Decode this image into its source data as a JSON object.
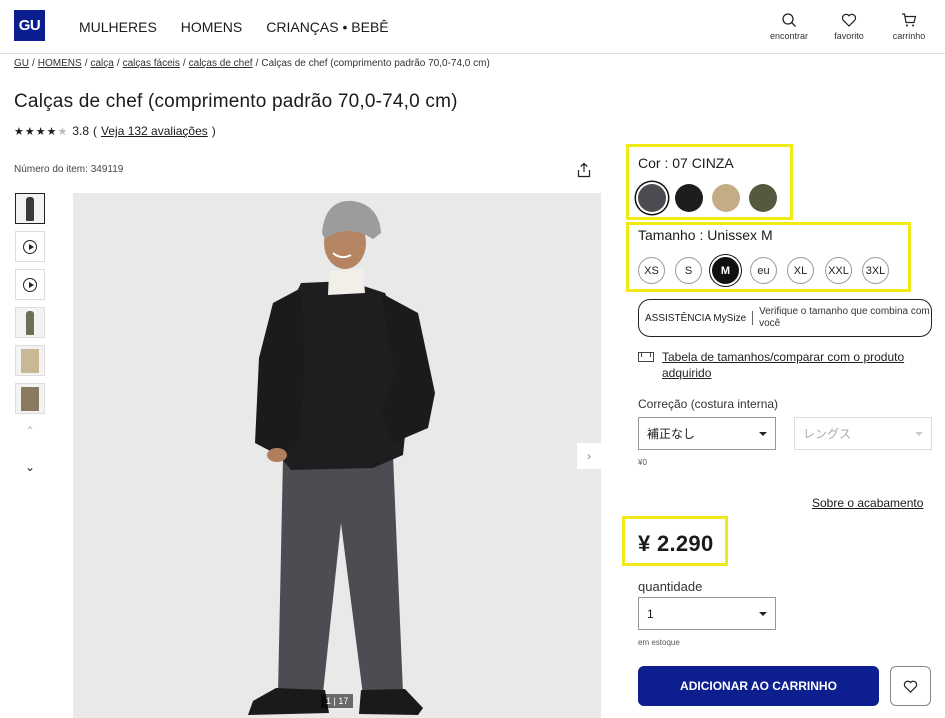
{
  "header": {
    "logo": "GU",
    "nav": [
      "MULHERES",
      "HOMENS",
      "CRIANÇAS • BEBÊ"
    ],
    "icons": [
      {
        "label": "encontrar",
        "icon": "search-icon"
      },
      {
        "label": "favorito",
        "icon": "heart-icon"
      },
      {
        "label": "carrinho",
        "icon": "cart-icon"
      }
    ]
  },
  "breadcrumb": [
    "GU",
    "HOMENS",
    "calça",
    "calças fáceis",
    "calças de chef",
    "Calças de chef (comprimento padrão 70,0-74,0 cm)"
  ],
  "product": {
    "title": "Calças de chef (comprimento padrão 70,0-74,0 cm)",
    "rating": "3.8",
    "reviews": "Veja 132 avaliações",
    "item_number": "Número do item: 349119",
    "image_counter": "1 | 17"
  },
  "color": {
    "label": "Cor :  07 CINZA",
    "swatches": [
      {
        "name": "cinza",
        "color": "#4a4c52",
        "selected": true
      },
      {
        "name": "preto",
        "color": "#1d1d1d",
        "selected": false
      },
      {
        "name": "bege",
        "color": "#c4ac86",
        "selected": false
      },
      {
        "name": "oliva",
        "color": "#545a40",
        "selected": false
      }
    ]
  },
  "size": {
    "label": "Tamanho :  Unissex M",
    "options": [
      "XS",
      "S",
      "M",
      "eu",
      "XL",
      "XXL",
      "3XL"
    ],
    "selected": "M"
  },
  "mysize": {
    "brand": "ASSISTÊNCIA MySize",
    "text": "Verifique o tamanho que combina com você"
  },
  "size_chart_link": "Tabela de tamanhos/comparar com o produto adquirido",
  "correction": {
    "label": "Correção (costura interna)",
    "select1": "補正なし",
    "select2": "レングス",
    "price_note": "¥0"
  },
  "finish_link": "Sobre o acabamento",
  "price": "¥ 2.290",
  "quantity": {
    "label": "quantidade",
    "value": "1",
    "stock": "em estoque"
  },
  "buttons": {
    "add_to_cart": "ADICIONAR AO CARRINHO"
  },
  "colors": {
    "brand": "#0d1e8f",
    "highlight": "#f2ea15"
  }
}
